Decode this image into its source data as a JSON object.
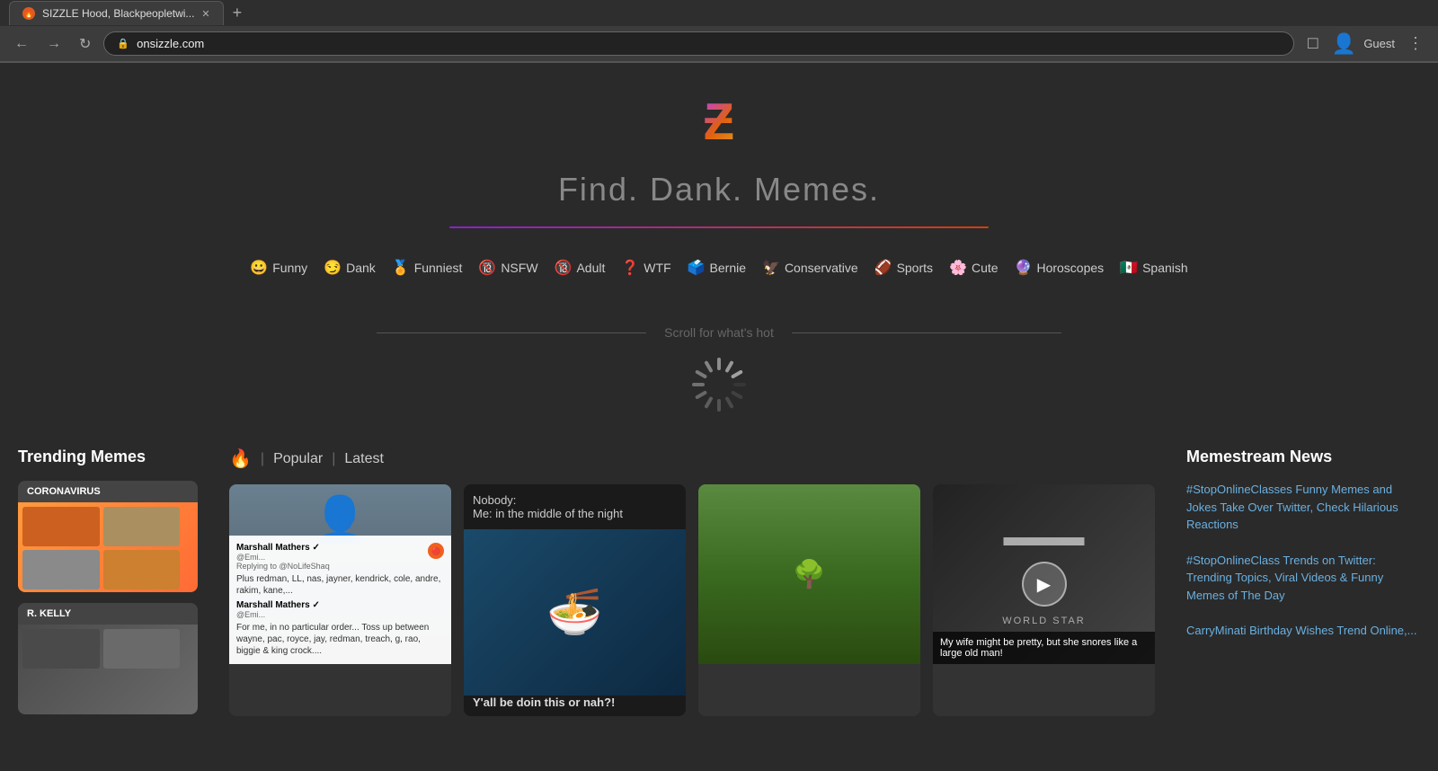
{
  "browser": {
    "tab_title": "SIZZLE Hood, Blackpeopletwi...",
    "url": "onsizzle.com",
    "tab_new_label": "+",
    "guest_label": "Guest"
  },
  "header": {
    "tagline": "Find. Dank. Memes.",
    "logo_symbol": "Ƶ"
  },
  "categories": [
    {
      "emoji": "😀",
      "label": "Funny"
    },
    {
      "emoji": "😏",
      "label": "Dank"
    },
    {
      "emoji": "🏅",
      "label": "Funniest"
    },
    {
      "emoji": "🔞",
      "label": "NSFW"
    },
    {
      "emoji": "🔞",
      "label": "Adult"
    },
    {
      "emoji": "❓",
      "label": "WTF"
    },
    {
      "emoji": "🗳️",
      "label": "Bernie"
    },
    {
      "emoji": "🦅",
      "label": "Conservative"
    },
    {
      "emoji": "🏈",
      "label": "Sports"
    },
    {
      "emoji": "🌸",
      "label": "Cute"
    },
    {
      "emoji": "🔮",
      "label": "Horoscopes"
    },
    {
      "emoji": "🇲🇽",
      "label": "Spanish"
    }
  ],
  "scroll_text": "Scroll for what's hot",
  "content": {
    "fire_emoji": "🔥",
    "filter_popular": "Popular",
    "filter_latest": "Latest",
    "memes": [
      {
        "caption_top": "",
        "caption_bottom": "",
        "type": "image_with_tweet",
        "tweet_name": "Marshall Mathers",
        "tweet_handle": "@Emi...",
        "tweet_reply": "Replying to @NoLifeShaq",
        "tweet_body1": "Plus redman, LL, nas, jayner, kendrick, cole, andre, rakim, kane,...",
        "tweet_name2": "Marshall Mathers",
        "tweet_handle2": "@Emi...",
        "tweet_body2": "For me, in no particular order... Toss up between wayne, pac, royce, jay, redman, treach, g, rao, biggie & king crock...."
      },
      {
        "caption_top": "Nobody:",
        "caption_subtitle": "Me: in the middle of the night",
        "caption_bottom": "Y'all be doin this or nah?!",
        "type": "spongebob"
      },
      {
        "caption_top": "",
        "caption_bottom": "",
        "type": "outdoor"
      },
      {
        "caption_top": "",
        "caption_bottom": "",
        "type": "video",
        "video_caption": "My wife might be pretty, but she snores like a large old man!"
      }
    ]
  },
  "sidebar_left": {
    "title": "Trending Memes",
    "items": [
      {
        "label": "CORONAVIRUS",
        "type": "coronavirus"
      },
      {
        "label": "R. KELLY",
        "type": "rkelly"
      }
    ]
  },
  "sidebar_right": {
    "title": "Memestream News",
    "news": [
      {
        "text": "#StopOnlineClasses Funny Memes and Jokes Take Over Twitter, Check Hilarious Reactions"
      },
      {
        "text": "#StopOnlineClass Trends on Twitter: Trending Topics, Viral Videos & Funny Memes of The Day"
      },
      {
        "text": "CarryMinati Birthday Wishes Trend Online,..."
      }
    ]
  }
}
